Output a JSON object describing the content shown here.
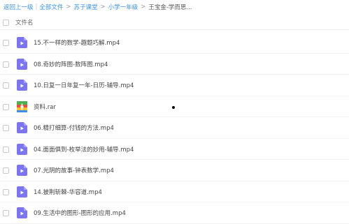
{
  "breadcrumb": {
    "back": "返回上一级",
    "all_files": "全部文件",
    "level1": "苏子课堂",
    "level2": "小学一年级",
    "current": "王宝金-学而思...",
    "pipe": "|",
    "sep": ">"
  },
  "header": {
    "column_name": "文件名"
  },
  "files": [
    {
      "name": "15.不一样的数学-趣题巧解.mp4",
      "type": "video"
    },
    {
      "name": "08.奇妙的阵图-数阵图.mp4",
      "type": "video"
    },
    {
      "name": "10.日复一日年复一年-日历-辅导.mp4",
      "type": "video"
    },
    {
      "name": "资料.rar",
      "type": "archive"
    },
    {
      "name": "06.精打细算-付钱的方法.mp4",
      "type": "video"
    },
    {
      "name": "04.面面俱到-枚举法的妙用-辅导.mp4",
      "type": "video"
    },
    {
      "name": "07.光阴的故事-钟表数学.mp4",
      "type": "video"
    },
    {
      "name": "14.披荆斩棘-华容道.mp4",
      "type": "video"
    },
    {
      "name": "09.生活中的图形-图形的应用.mp4",
      "type": "video"
    }
  ],
  "colors": {
    "link": "#3e93e8",
    "video_icon": "#7b76f0",
    "archive_green": "#4caf50",
    "archive_red": "#e94d3b",
    "archive_yellow": "#f2c230",
    "archive_blue": "#3d8df0"
  },
  "icons": {
    "video": "video-file-icon",
    "archive": "archive-file-icon"
  }
}
